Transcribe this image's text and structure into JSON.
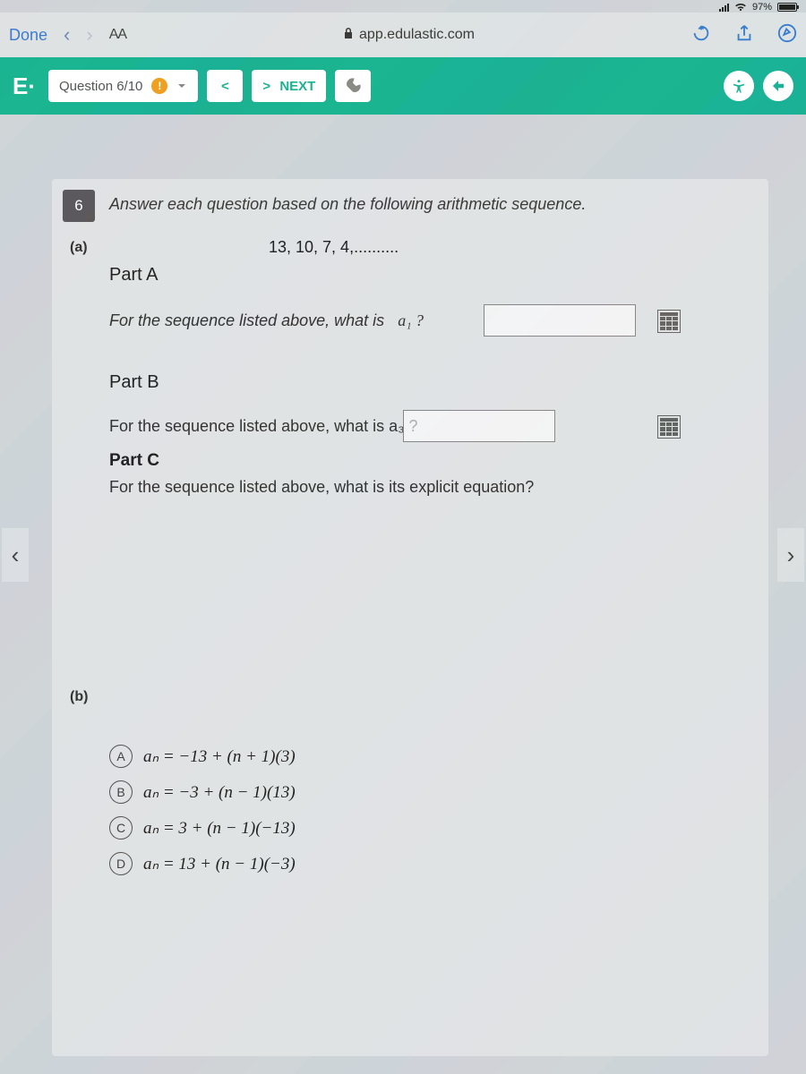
{
  "status": {
    "battery_pct": "97%"
  },
  "safari": {
    "done": "Done",
    "aa": "AA",
    "host": "app.edulastic.com"
  },
  "header": {
    "brand": "E·",
    "question_label": "Question 6/10",
    "next_label": "NEXT"
  },
  "question": {
    "number": "6",
    "prompt": "Answer each question based on the following arithmetic sequence.",
    "sub_a": "(a)",
    "sequence": "13, 10, 7, 4,..........",
    "partA_heading": "Part A",
    "partA_text": "For the sequence listed above, what is",
    "partA_term": "a₁ ?",
    "partB_heading": "Part B",
    "partB_text": "For the sequence listed above, what is a₃ ?",
    "partC_heading": "Part C",
    "partC_text": "For the sequence listed above, what is its explicit equation?",
    "sub_b": "(b)",
    "choices": {
      "A": "aₙ = −13 + (n + 1)(3)",
      "B": "aₙ = −3 + (n − 1)(13)",
      "C": "aₙ = 3 + (n − 1)(−13)",
      "D": "aₙ = 13 + (n − 1)(−3)"
    }
  }
}
